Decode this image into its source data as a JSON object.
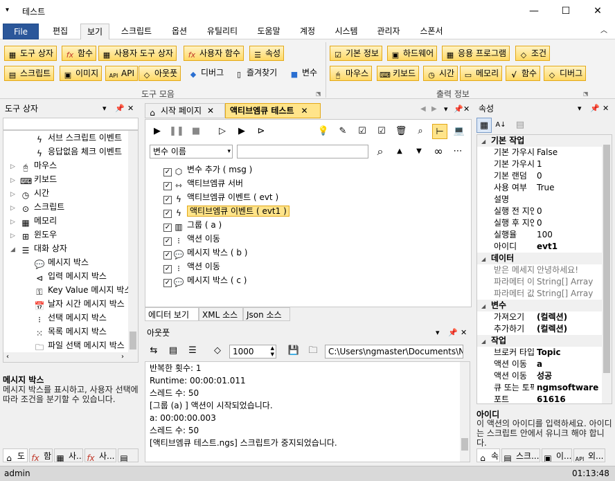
{
  "window": {
    "title": "테스트",
    "minimize": "—",
    "maximize": "☐",
    "close": "✕"
  },
  "menu": {
    "file": "File",
    "tabs": [
      "편집",
      "보기",
      "스크립트",
      "옵션",
      "유틸리티",
      "도움말",
      "계정",
      "시스템",
      "관리자",
      "스폰서"
    ]
  },
  "ribbon": {
    "group1": {
      "row1": [
        "도구 상자",
        "함수",
        "사용자 도구 상자",
        "사용자 함수",
        "속성"
      ],
      "row2": [
        "스크립트",
        "이미지",
        "API",
        "아웃풋",
        "디버그",
        "즐겨찾기",
        "변수"
      ],
      "label": "도구 모음"
    },
    "group2": {
      "row1": [
        "기본 정보",
        "하드웨어",
        "응용 프로그램",
        "조건"
      ],
      "row2": [
        "마우스",
        "키보드",
        "시간",
        "메모리",
        "함수",
        "디버그"
      ],
      "label": "출력 정보"
    }
  },
  "toolbox": {
    "title": "도구 상자",
    "items": [
      {
        "label": "서브 스크립트 이벤트",
        "level": 2,
        "icon": "lightning-icon"
      },
      {
        "label": "응답없음 체크 이벤트",
        "level": 2,
        "icon": "lightning-icon"
      },
      {
        "label": "마우스",
        "level": 1,
        "icon": "mouse-icon"
      },
      {
        "label": "키보드",
        "level": 1,
        "icon": "keyboard-icon"
      },
      {
        "label": "시간",
        "level": 1,
        "icon": "clock-icon"
      },
      {
        "label": "스크립트",
        "level": 1,
        "icon": "script-icon"
      },
      {
        "label": "메모리",
        "level": 1,
        "icon": "memory-icon"
      },
      {
        "label": "윈도우",
        "level": 1,
        "icon": "windows-icon"
      },
      {
        "label": "대화 상자",
        "level": 1,
        "icon": "dialog-icon",
        "expanded": true
      },
      {
        "label": "메시지 박스",
        "level": 2,
        "icon": "message-icon"
      },
      {
        "label": "입력 메시지 박스",
        "level": 2,
        "icon": "input-message-icon"
      },
      {
        "label": "Key Value 메시지 박스",
        "level": 2,
        "icon": "key-value-icon"
      },
      {
        "label": "날자 시간 메시지 박스",
        "level": 2,
        "icon": "calendar-icon"
      },
      {
        "label": "선택 메시지 박스",
        "level": 2,
        "icon": "select-icon"
      },
      {
        "label": "목록 메시지 박스",
        "level": 2,
        "icon": "list-icon"
      },
      {
        "label": "파일 선택 메시지 박스",
        "level": 2,
        "icon": "folder-icon"
      }
    ],
    "desc_title": "메시지 박스",
    "desc_text": "메시지 박스를 표시하고, 사용자 선택에 따라 조건을 분기할 수 있습니다.",
    "bottom_tabs": [
      "도",
      "함",
      "사...",
      "사...",
      ""
    ]
  },
  "editor": {
    "tabs": [
      "시작 페이지",
      "액티브엠큐 테스트"
    ],
    "var_combo": "변수 이름",
    "search_value": "",
    "tree": [
      {
        "label": "변수 추가 ( msg )",
        "level": 0,
        "icon": "cube-icon"
      },
      {
        "label": "액티브엠큐 서버",
        "level": 0,
        "icon": "server-icon"
      },
      {
        "label": "액티브엠큐 이벤트 ( evt )",
        "level": 0,
        "icon": "lightning-icon"
      },
      {
        "label": "액티브엠큐 이벤트 ( evt1 )",
        "level": 0,
        "icon": "lightning-icon",
        "selected": true
      },
      {
        "label": "그룹 ( a )",
        "level": 0,
        "icon": "group-icon"
      },
      {
        "label": "액션 이동",
        "level": 0,
        "icon": "action-icon"
      },
      {
        "label": "메시지 박스 ( b )",
        "level": 0,
        "icon": "message-icon"
      },
      {
        "label": "액션 이동",
        "level": 0,
        "icon": "action-icon"
      },
      {
        "label": "메시지 박스 ( c )",
        "level": 0,
        "icon": "message-icon"
      }
    ],
    "bottom_tabs": [
      "에디터 보기",
      "XML 소스",
      "Json 소스"
    ]
  },
  "output": {
    "title": "아웃풋",
    "count_value": "1000",
    "path": "C:\\Users\\ngmaster\\Documents\\NGM",
    "lines": [
      "반복한 횟수: 1",
      "Runtime: 00:00:01.011",
      "스레드 수: 50",
      "[그룹 (a) ] 액션이 시작되었습니다.",
      "a: 00:00:00.003",
      "스레드 수: 50",
      "[액티브엠큐 테스트.ngs] 스크립트가 중지되었습니다."
    ]
  },
  "properties": {
    "title": "속성",
    "categories": [
      {
        "name": "기본 작업",
        "rows": [
          [
            "기본 가우시안",
            "False"
          ],
          [
            "기본 가우시안 범위",
            "1"
          ],
          [
            "기본 랜덤",
            "0"
          ],
          [
            "사용 여부",
            "True"
          ],
          [
            "설명",
            ""
          ],
          [
            "실행 전 지연",
            "0"
          ],
          [
            "실행 후 지연",
            "0"
          ],
          [
            "실행율",
            "100"
          ],
          [
            "아이디",
            "evt1"
          ]
        ]
      },
      {
        "name": "데이터",
        "rows": [
          [
            "받은 메세지",
            "안녕하세요!"
          ],
          [
            "파라메터 이름",
            "String[] Array"
          ],
          [
            "파라메터 값",
            "String[] Array"
          ]
        ]
      },
      {
        "name": "변수",
        "rows": [
          [
            "가져오기",
            "(컬렉션)"
          ],
          [
            "추가하기",
            "(컬렉션)"
          ]
        ]
      },
      {
        "name": "작업",
        "rows": [
          [
            "브로커 타입",
            "Topic"
          ],
          [
            "액션 이동",
            "a"
          ],
          [
            "액션 이동",
            "성공"
          ],
          [
            "큐 또는 토픽",
            "ngmsoftware"
          ],
          [
            "포트",
            "61616"
          ]
        ]
      }
    ],
    "desc_title": "아이디",
    "desc_text": "이 액션의 아이디를 입력하세요. 아이디는 스크립트 안에서 유니크 해야 합니다.",
    "bottom_tabs": [
      "속",
      "스크...",
      "이...",
      "외..."
    ]
  },
  "status": {
    "user": "admin",
    "time": "01:13:48"
  }
}
